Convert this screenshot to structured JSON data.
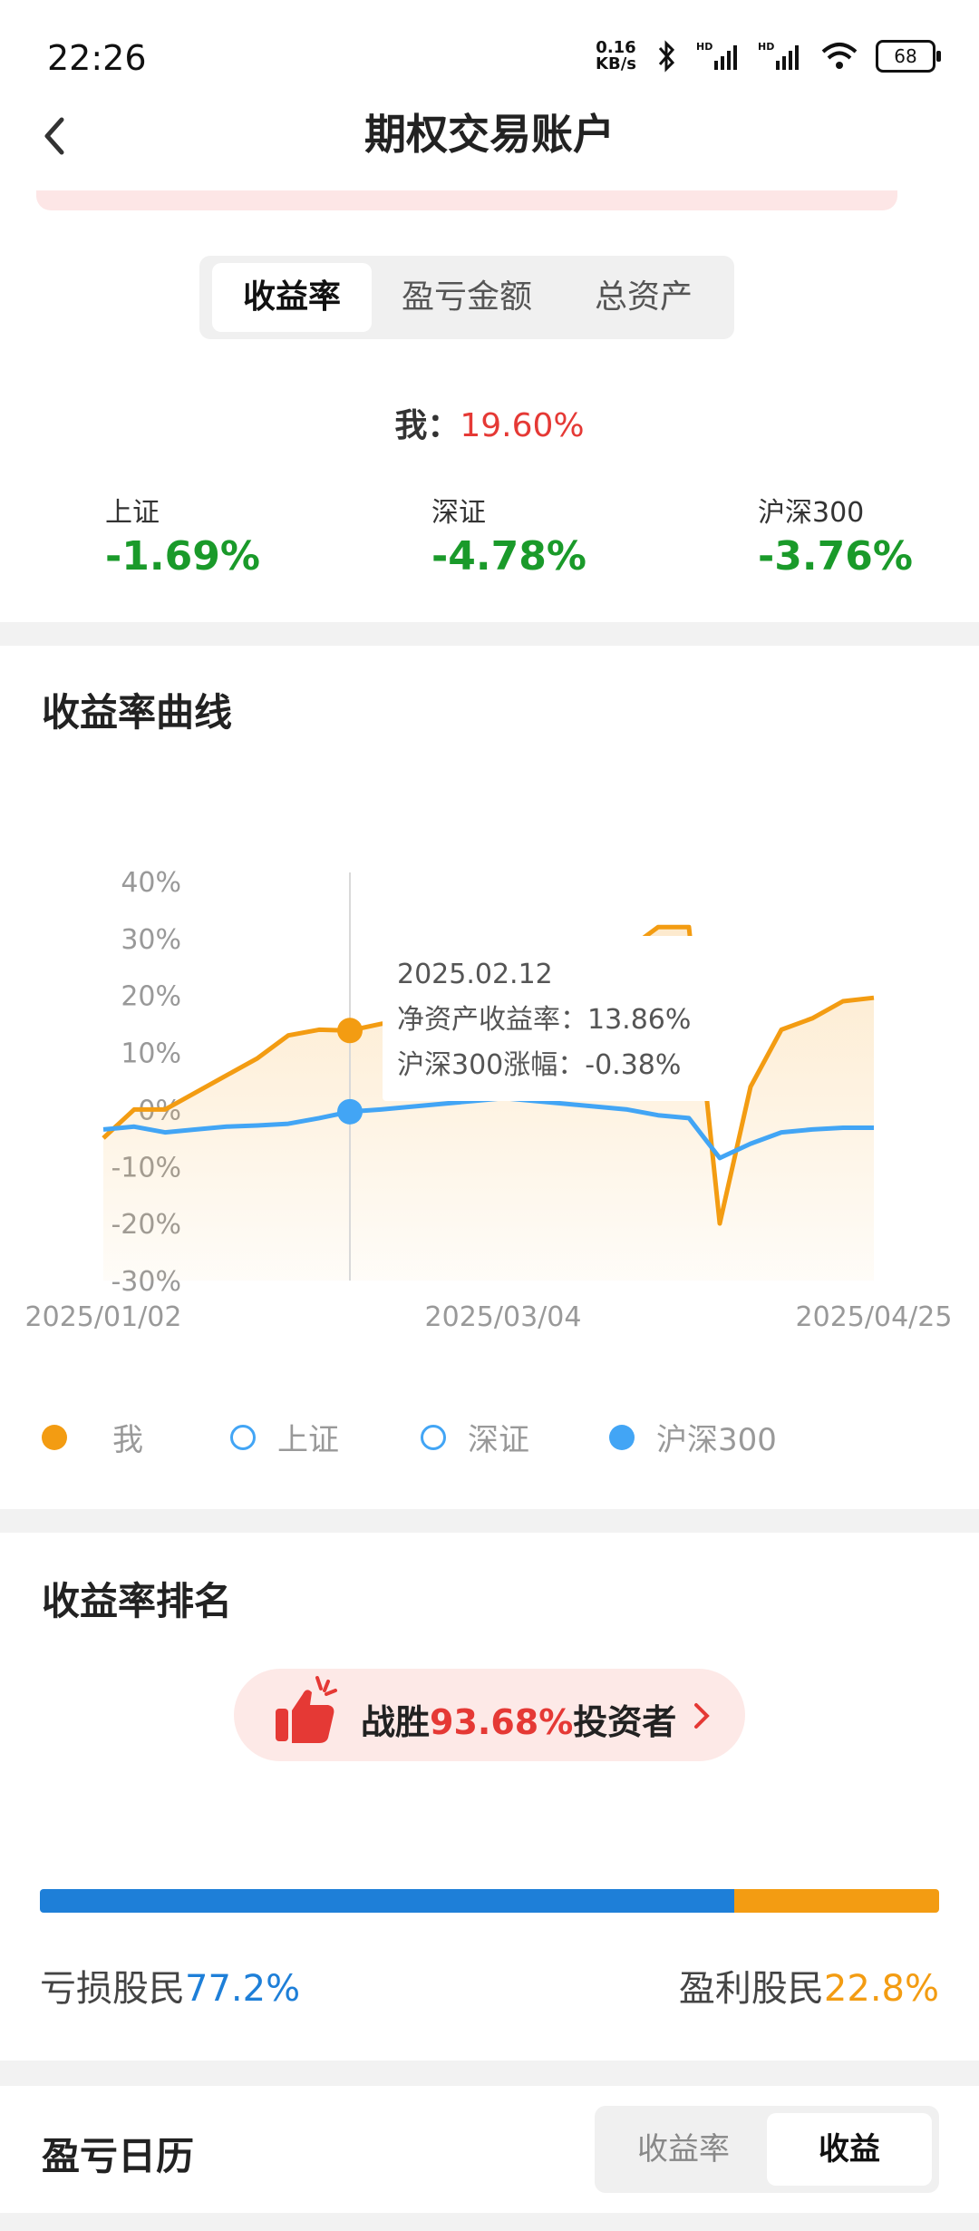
{
  "status": {
    "time": "22:26",
    "netspeed_value": "0.16",
    "netspeed_unit": "KB/s",
    "battery": "68"
  },
  "header": {
    "title": "期权交易账户"
  },
  "tabs": {
    "items": [
      "收益率",
      "盈亏金额",
      "总资产"
    ],
    "active": 0
  },
  "summary": {
    "me_label": "我：",
    "me_value": "19.60%",
    "indexes": [
      {
        "name": "上证",
        "value": "-1.69%"
      },
      {
        "name": "深证",
        "value": "-4.78%"
      },
      {
        "name": "沪深300",
        "value": "-3.76%"
      }
    ]
  },
  "curve_section": {
    "title": "收益率曲线"
  },
  "chart_data": {
    "type": "line",
    "title": "",
    "ylabel": "",
    "xlabel": "",
    "ylim": [
      -30,
      40
    ],
    "y_ticks": [
      "40%",
      "30%",
      "20%",
      "10%",
      "0%",
      "-10%",
      "-20%",
      "-30%"
    ],
    "x_ticks": [
      "2025/01/02",
      "2025/03/04",
      "2025/04/25"
    ],
    "x": [
      "2025/01/02",
      "2025/01/07",
      "2025/01/12",
      "2025/01/17",
      "2025/01/22",
      "2025/01/27",
      "2025/02/01",
      "2025/02/06",
      "2025/02/12",
      "2025/02/17",
      "2025/02/22",
      "2025/02/27",
      "2025/03/04",
      "2025/03/09",
      "2025/03/14",
      "2025/03/19",
      "2025/03/24",
      "2025/03/29",
      "2025/04/03",
      "2025/04/05",
      "2025/04/07",
      "2025/04/09",
      "2025/04/12",
      "2025/04/16",
      "2025/04/20",
      "2025/04/25"
    ],
    "series": [
      {
        "name": "我",
        "color": "#f39c12",
        "values": [
          -5,
          0,
          0,
          3,
          6,
          9,
          13,
          14,
          13.86,
          15,
          16,
          17,
          18,
          20,
          22,
          23,
          26,
          28,
          32,
          32,
          -20,
          4,
          14,
          16,
          19,
          19.6
        ]
      },
      {
        "name": "沪深300",
        "color": "#42a5f5",
        "values": [
          -3.5,
          -3,
          -4,
          -3.5,
          -3,
          -2.8,
          -2.5,
          -1.5,
          -0.38,
          0,
          0.5,
          1,
          1.5,
          2,
          1.5,
          1,
          0.5,
          0,
          -1,
          -1.5,
          -8.5,
          -6,
          -4,
          -3.5,
          -3.2,
          -3.2
        ]
      }
    ],
    "tooltip": {
      "date": "2025.02.12",
      "line1": "净资产收益率：13.86%",
      "line2": "沪深300涨幅：-0.38%",
      "index": 8
    },
    "legend": [
      {
        "name": "我",
        "color": "#f39c12",
        "filled": true
      },
      {
        "name": "上证",
        "color": "#42a5f5",
        "filled": false
      },
      {
        "name": "深证",
        "color": "#42a5f5",
        "filled": false
      },
      {
        "name": "沪深300",
        "color": "#42a5f5",
        "filled": true
      }
    ]
  },
  "ranking": {
    "title": "收益率排名",
    "beat_prefix": "战胜",
    "beat_value": "93.68%",
    "beat_suffix": "投资者",
    "loss_label": "亏损股民",
    "loss_value": "77.2%",
    "loss_color": "#1e7fd8",
    "profit_label": "盈利股民",
    "profit_value": "22.8%",
    "profit_color": "#f39c12",
    "loss_fraction": 0.772
  },
  "calendar": {
    "title": "盈亏日历",
    "options": [
      "收益率",
      "收益"
    ],
    "active": 1
  }
}
